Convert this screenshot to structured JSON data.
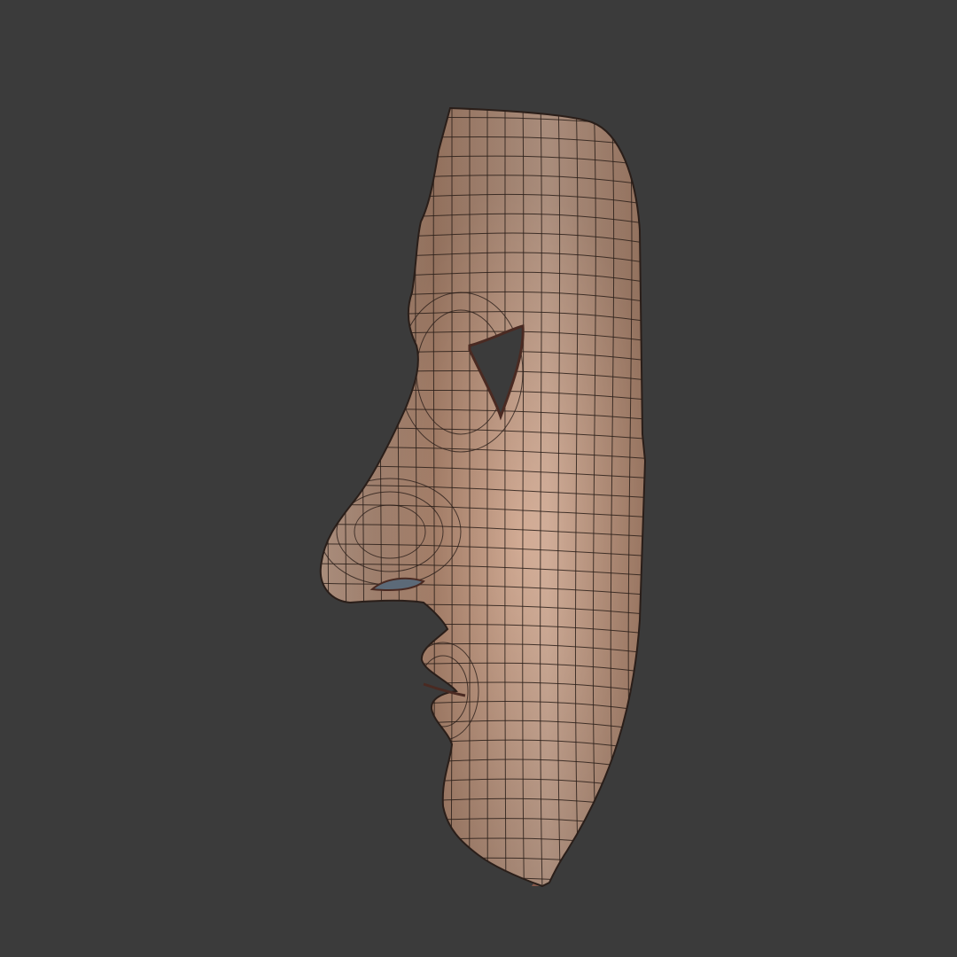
{
  "scene": {
    "background_color": "#3b3b3b",
    "subject": "mask-wireframe",
    "mesh_colors": {
      "skin_light": "#d9b49e",
      "skin_mid": "#bb9077",
      "skin_dark": "#85584a",
      "edge_dark": "#4a2a22",
      "wire": "#2a1e19",
      "eye_hole": "#3b3b3b"
    }
  }
}
